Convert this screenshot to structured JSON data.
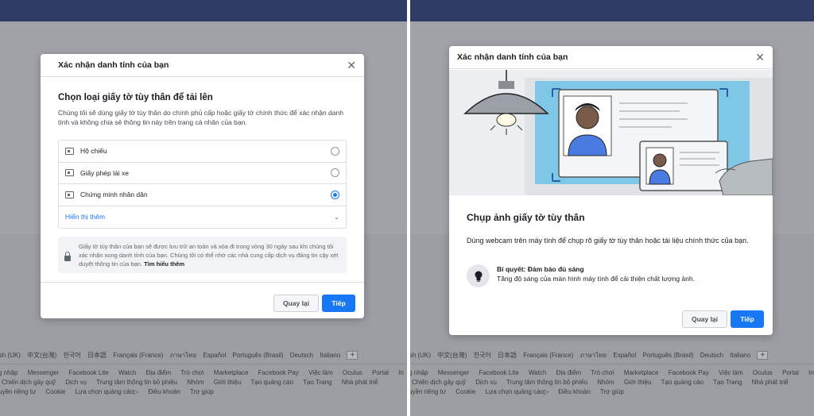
{
  "dialog1": {
    "title": "Xác nhận danh tính của bạn",
    "heading": "Chọn loại giấy tờ tùy thân để tải lên",
    "description": "Chúng tôi sẽ dùng giấy tờ tùy thân do chính phủ cấp hoặc giấy tờ chính thức để xác nhận danh tính và không chia sẻ thông tin này trên trang cá nhân của bạn.",
    "options": [
      {
        "label": "Hộ chiếu",
        "selected": false
      },
      {
        "label": "Giấy phép lái xe",
        "selected": false
      },
      {
        "label": "Chứng minh nhân dân",
        "selected": true
      }
    ],
    "show_more": "Hiển thị thêm",
    "info_text": "Giấy tờ tùy thân của bạn sẽ được lưu trữ an toàn và xóa đi trong vòng 30 ngày sau khi chúng tôi xác nhận xong danh tính của bạn. Chúng tôi có thể nhờ các nhà cung cấp dịch vụ đáng tin cậy xét duyệt thông tin của bạn.",
    "learn_more": "Tìm hiểu thêm",
    "back_label": "Quay lại",
    "next_label": "Tiếp"
  },
  "dialog2": {
    "title": "Xác nhận danh tính của bạn",
    "heading": "Chụp ảnh giấy tờ tùy thân",
    "description": "Dùng webcam trên máy tính để chụp rõ giấy tờ tùy thân hoặc tài liệu chính thức của bạn.",
    "tip_title": "Bí quyết: Đảm bảo đủ sáng",
    "tip_text": "Tăng độ sáng của màn hình máy tính để cải thiện chất lượng ảnh.",
    "back_label": "Quay lại",
    "next_label": "Tiếp"
  },
  "footer_left": {
    "languages": [
      "ish (UK)",
      "中文(台灣)",
      "한국어",
      "日本語",
      "Français (France)",
      "ภาษาไทย",
      "Español",
      "Português (Brasil)",
      "Deutsch",
      "Italiano"
    ],
    "plus": "+",
    "row1": [
      "g nhập",
      "Messenger",
      "Facebook Lite",
      "Watch",
      "Địa điểm",
      "Trò chơi",
      "Marketplace",
      "Facebook Pay",
      "Việc làm",
      "Oculus",
      "Portal",
      "In"
    ],
    "row2": [
      "Chiến dịch gây quỹ",
      "Dịch vụ",
      "Trung tâm thông tin bỏ phiếu",
      "Nhóm",
      "Giới thiệu",
      "Tạo quảng cáo",
      "Tạo Trang",
      "Nhà phát triể"
    ],
    "row3": [
      "uyền riêng tư",
      "Cookie",
      "Lựa chọn quảng cáo▷",
      "Điều khoản",
      "Trợ giúp"
    ]
  },
  "footer_right": {
    "languages": [
      "ish (UK)",
      "中文(台灣)",
      "한국어",
      "日本語",
      "Français (France)",
      "ภาษาไทย",
      "Español",
      "Português (Brasil)",
      "Deutsch",
      "Italiano"
    ],
    "plus": "+",
    "row1": [
      "g nhập",
      "Messenger",
      "Facebook Lite",
      "Watch",
      "Địa điểm",
      "Trò chơi",
      "Marketplace",
      "Facebook Pay",
      "Việc làm",
      "Oculus",
      "Portal",
      "In"
    ],
    "row2": [
      "Chiến dịch gây quỹ",
      "Dịch vụ",
      "Trung tâm thông tin bỏ phiếu",
      "Nhóm",
      "Giới thiệu",
      "Tạo quảng cáo",
      "Tạo Trang",
      "Nhà phát triể"
    ],
    "row3": [
      "uyền riêng tư",
      "Cookie",
      "Lựa chọn quảng cáo▷",
      "Điều khoản",
      "Trợ giúp"
    ]
  },
  "colors": {
    "topbar": "#2e3c63",
    "accent": "#1877f2",
    "illustration_blue": "#7fc7e6",
    "person_shirt": "#4a7be0"
  },
  "icons": {
    "close": "close-icon",
    "document": "id-card-icon",
    "lock": "lock-icon",
    "bulb": "light-bulb-icon",
    "chevron": "chevron-down-icon"
  }
}
